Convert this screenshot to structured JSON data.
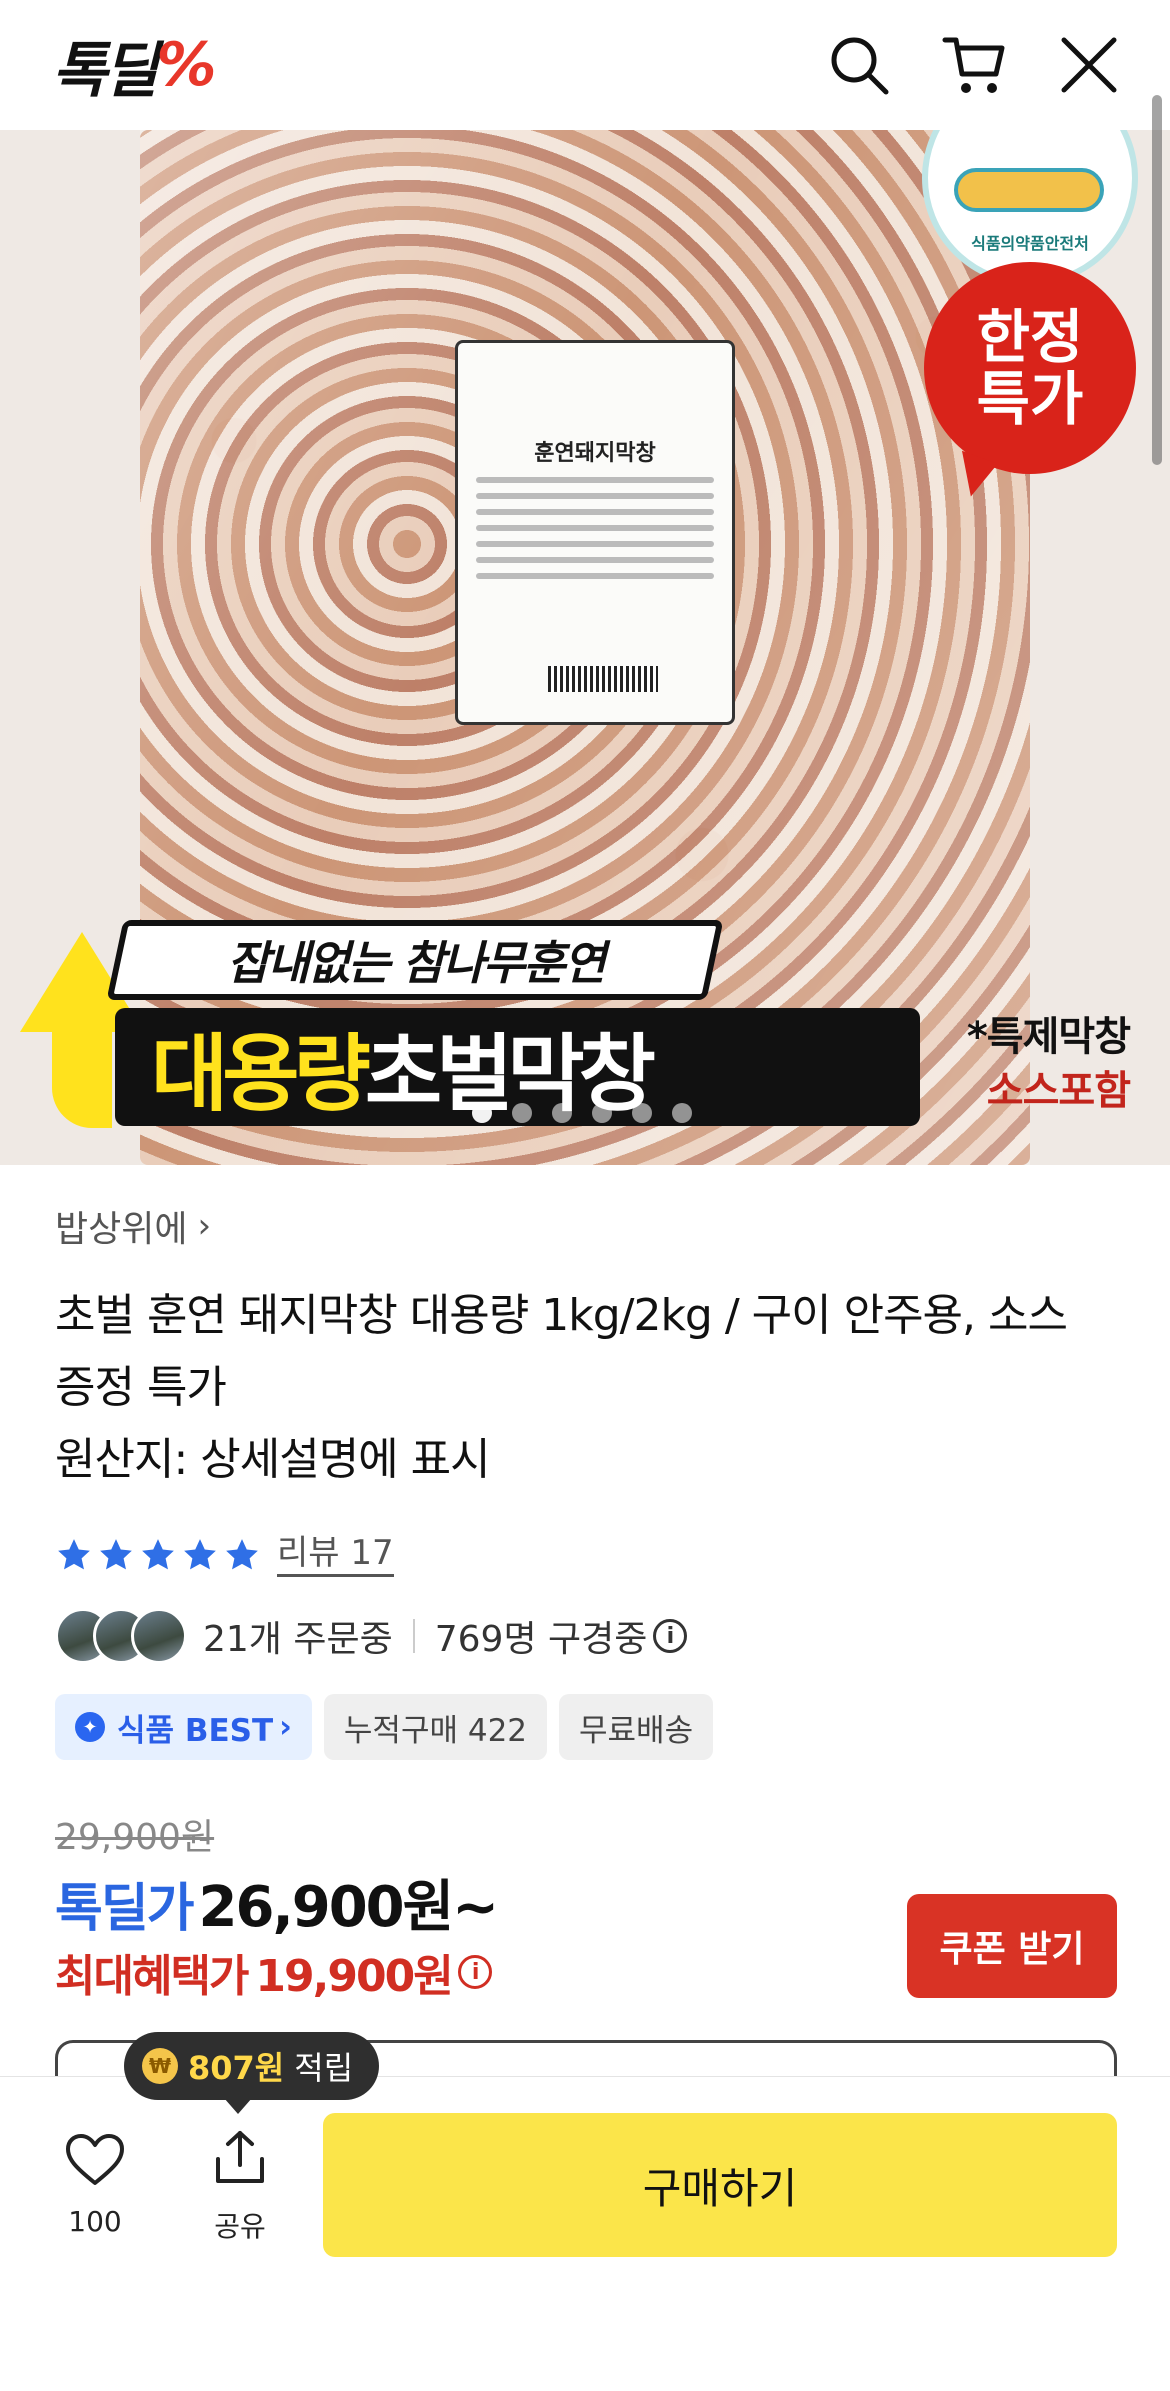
{
  "header": {
    "logo_text": "톡딜",
    "logo_mark": "%",
    "icons": [
      "search-icon",
      "cart-icon",
      "close-icon"
    ]
  },
  "hero": {
    "package_label": "훈연돼지막창",
    "haccp_text": "식품의약품안전처",
    "badge_line1": "한정",
    "badge_line2": "특가",
    "banner_sub": "잡내없는 참나무훈연",
    "banner_main_yellow": "대용량",
    "banner_main_white": "초벌막창",
    "note_line1": "*특제막창",
    "note_line2": "소스포함",
    "dots_total": 6,
    "dots_active_index": 0
  },
  "product": {
    "store": "밥상위에",
    "title": "초벌 훈연 돼지막창 대용량 1kg/2kg / 구이 안주용, 소스 증정 특가",
    "origin": "원산지: 상세설명에 표시",
    "rating": 5,
    "reviews": "리뷰 17",
    "orders": "21개 주문중",
    "viewers": "769명 구경중"
  },
  "tags": [
    {
      "label": "식품 BEST",
      "icon": "star-badge-icon"
    },
    {
      "label": "누적구매 422"
    },
    {
      "label": "무료배송"
    }
  ],
  "price": {
    "original": "29,900원",
    "deal_label": "톡딜가",
    "deal_value": "26,900원~",
    "max_label": "최대혜택가",
    "max_value": "19,900원",
    "coupon_button": "쿠폰 받기"
  },
  "bottom": {
    "points_amount": "807원",
    "points_suffix": "적립",
    "like_count": "100",
    "share_label": "공유",
    "buy_button": "구매하기"
  },
  "colors": {
    "accent_blue": "#2a66e0",
    "accent_red": "#d12e22",
    "buy_yellow": "#fbe54a",
    "coupon_red": "#d93325"
  }
}
